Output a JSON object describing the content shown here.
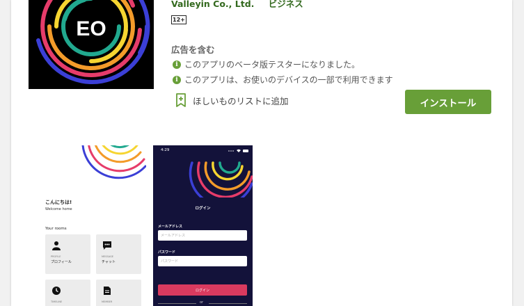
{
  "app": {
    "developer": "Valleyin Co., Ltd.",
    "category": "ビジネス",
    "content_rating": "12+",
    "ads_label": "広告を含む",
    "notes": [
      "このアプリのベータ版テスターになりました。",
      "このアプリは、お使いのデバイスの一部で利用できます"
    ],
    "wishlist_label": "ほしいものリストに追加",
    "install_label": "インストール",
    "icon_text": "EO"
  },
  "screenshot_home": {
    "greeting": "こんにちは!",
    "welcome": "Welcome home",
    "section": "Your rooms",
    "tiles": [
      {
        "small": "PROFILE",
        "label": "プロフィール",
        "icon": "person-icon"
      },
      {
        "small": "MESSAGE",
        "label": "チャット",
        "icon": "chat-icon"
      },
      {
        "small": "TIMELINE",
        "label": "",
        "icon": "clock-icon"
      },
      {
        "small": "MEMBER",
        "label": "",
        "icon": "document-icon"
      }
    ]
  },
  "screenshot_login": {
    "time": "4:29",
    "title": "ログイン",
    "email_label": "メールアドレス",
    "email_placeholder": "メールアドレス",
    "password_label": "パスワード",
    "password_placeholder": "パスワード",
    "login_button": "ログイン",
    "or_text": "or"
  },
  "colors": {
    "accent_green": "#689f38",
    "developer_green": "#33691e",
    "login_bg": "#13123a",
    "login_button": "#d93a5f"
  }
}
